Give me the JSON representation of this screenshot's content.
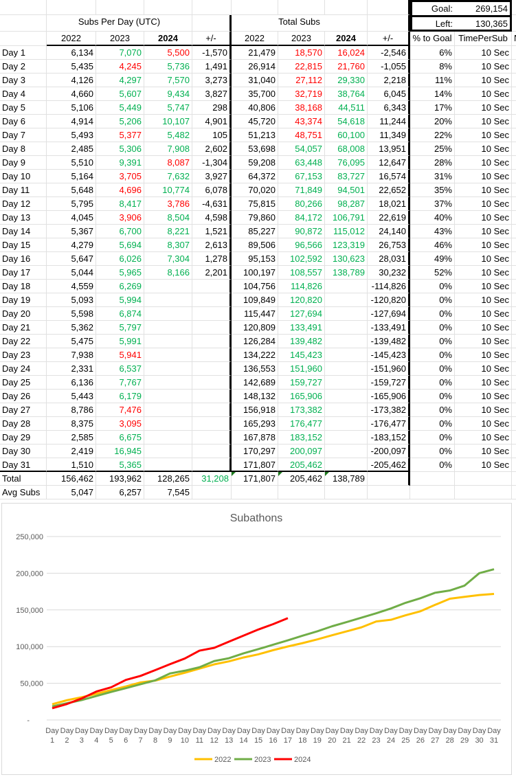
{
  "summary": {
    "goal_label": "Goal:",
    "goal_value": "269,154",
    "left_label": "Left:",
    "left_value": "130,365"
  },
  "headers": {
    "subs_per_day": "Subs Per Day (UTC)",
    "total_subs": "Total Subs",
    "cols": [
      "2022",
      "2023",
      "2024",
      "+/-",
      "2022",
      "2023",
      "2024",
      "+/-",
      "% to Goal",
      "TimePerSub",
      "N"
    ]
  },
  "rows": [
    [
      "Day 1",
      "6,134",
      "7,070",
      "5,500",
      "-1,570",
      "21,479",
      "18,570",
      "16,024",
      "-2,546",
      "6%",
      "10 Sec"
    ],
    [
      "Day 2",
      "5,435",
      "4,245",
      "5,736",
      "1,491",
      "26,914",
      "22,815",
      "21,760",
      "-1,055",
      "8%",
      "10 Sec"
    ],
    [
      "Day 3",
      "4,126",
      "4,297",
      "7,570",
      "3,273",
      "31,040",
      "27,112",
      "29,330",
      "2,218",
      "11%",
      "10 Sec"
    ],
    [
      "Day 4",
      "4,660",
      "5,607",
      "9,434",
      "3,827",
      "35,700",
      "32,719",
      "38,764",
      "6,045",
      "14%",
      "10 Sec"
    ],
    [
      "Day 5",
      "5,106",
      "5,449",
      "5,747",
      "298",
      "40,806",
      "38,168",
      "44,511",
      "6,343",
      "17%",
      "10 Sec"
    ],
    [
      "Day 6",
      "4,914",
      "5,206",
      "10,107",
      "4,901",
      "45,720",
      "43,374",
      "54,618",
      "11,244",
      "20%",
      "10 Sec"
    ],
    [
      "Day 7",
      "5,493",
      "5,377",
      "5,482",
      "105",
      "51,213",
      "48,751",
      "60,100",
      "11,349",
      "22%",
      "10 Sec"
    ],
    [
      "Day 8",
      "2,485",
      "5,306",
      "7,908",
      "2,602",
      "53,698",
      "54,057",
      "68,008",
      "13,951",
      "25%",
      "10 Sec"
    ],
    [
      "Day 9",
      "5,510",
      "9,391",
      "8,087",
      "-1,304",
      "59,208",
      "63,448",
      "76,095",
      "12,647",
      "28%",
      "10 Sec"
    ],
    [
      "Day 10",
      "5,164",
      "3,705",
      "7,632",
      "3,927",
      "64,372",
      "67,153",
      "83,727",
      "16,574",
      "31%",
      "10 Sec"
    ],
    [
      "Day 11",
      "5,648",
      "4,696",
      "10,774",
      "6,078",
      "70,020",
      "71,849",
      "94,501",
      "22,652",
      "35%",
      "10 Sec"
    ],
    [
      "Day 12",
      "5,795",
      "8,417",
      "3,786",
      "-4,631",
      "75,815",
      "80,266",
      "98,287",
      "18,021",
      "37%",
      "10 Sec"
    ],
    [
      "Day 13",
      "4,045",
      "3,906",
      "8,504",
      "4,598",
      "79,860",
      "84,172",
      "106,791",
      "22,619",
      "40%",
      "10 Sec"
    ],
    [
      "Day 14",
      "5,367",
      "6,700",
      "8,221",
      "1,521",
      "85,227",
      "90,872",
      "115,012",
      "24,140",
      "43%",
      "10 Sec"
    ],
    [
      "Day 15",
      "4,279",
      "5,694",
      "8,307",
      "2,613",
      "89,506",
      "96,566",
      "123,319",
      "26,753",
      "46%",
      "10 Sec"
    ],
    [
      "Day 16",
      "5,647",
      "6,026",
      "7,304",
      "1,278",
      "95,153",
      "102,592",
      "130,623",
      "28,031",
      "49%",
      "10 Sec"
    ],
    [
      "Day 17",
      "5,044",
      "5,965",
      "8,166",
      "2,201",
      "100,197",
      "108,557",
      "138,789",
      "30,232",
      "52%",
      "10 Sec"
    ],
    [
      "Day 18",
      "4,559",
      "6,269",
      "",
      "",
      "104,756",
      "114,826",
      "",
      "-114,826",
      "0%",
      "10 Sec"
    ],
    [
      "Day 19",
      "5,093",
      "5,994",
      "",
      "",
      "109,849",
      "120,820",
      "",
      "-120,820",
      "0%",
      "10 Sec"
    ],
    [
      "Day 20",
      "5,598",
      "6,874",
      "",
      "",
      "115,447",
      "127,694",
      "",
      "-127,694",
      "0%",
      "10 Sec"
    ],
    [
      "Day 21",
      "5,362",
      "5,797",
      "",
      "",
      "120,809",
      "133,491",
      "",
      "-133,491",
      "0%",
      "10 Sec"
    ],
    [
      "Day 22",
      "5,475",
      "5,991",
      "",
      "",
      "126,284",
      "139,482",
      "",
      "-139,482",
      "0%",
      "10 Sec"
    ],
    [
      "Day 23",
      "7,938",
      "5,941",
      "",
      "",
      "134,222",
      "145,423",
      "",
      "-145,423",
      "0%",
      "10 Sec"
    ],
    [
      "Day 24",
      "2,331",
      "6,537",
      "",
      "",
      "136,553",
      "151,960",
      "",
      "-151,960",
      "0%",
      "10 Sec"
    ],
    [
      "Day 25",
      "6,136",
      "7,767",
      "",
      "",
      "142,689",
      "159,727",
      "",
      "-159,727",
      "0%",
      "10 Sec"
    ],
    [
      "Day 26",
      "5,443",
      "6,179",
      "",
      "",
      "148,132",
      "165,906",
      "",
      "-165,906",
      "0%",
      "10 Sec"
    ],
    [
      "Day 27",
      "8,786",
      "7,476",
      "",
      "",
      "156,918",
      "173,382",
      "",
      "-173,382",
      "0%",
      "10 Sec"
    ],
    [
      "Day 28",
      "8,375",
      "3,095",
      "",
      "",
      "165,293",
      "176,477",
      "",
      "-176,477",
      "0%",
      "10 Sec"
    ],
    [
      "Day 29",
      "2,585",
      "6,675",
      "",
      "",
      "167,878",
      "183,152",
      "",
      "-183,152",
      "0%",
      "10 Sec"
    ],
    [
      "Day 30",
      "2,419",
      "16,945",
      "",
      "",
      "170,297",
      "200,097",
      "",
      "-200,097",
      "0%",
      "10 Sec"
    ],
    [
      "Day 31",
      "1,510",
      "5,365",
      "",
      "",
      "171,807",
      "205,462",
      "",
      "-205,462",
      "0%",
      "10 Sec"
    ]
  ],
  "total_row": [
    "Total",
    "156,462",
    "193,962",
    "128,265",
    "31,208",
    "171,807",
    "205,462",
    "138,789"
  ],
  "avg_row": [
    "Avg Subs",
    "5,047",
    "6,257",
    "7,545"
  ],
  "colors": {
    "up": "#00B050",
    "down": "#FF0000",
    "s2022": "#FFC000",
    "s2023": "#70AD47",
    "s2024": "#FF0000"
  },
  "chart_data": {
    "type": "line",
    "title": "Subathons",
    "categories": [
      "Day 1",
      "Day 2",
      "Day 3",
      "Day 4",
      "Day 5",
      "Day 6",
      "Day 7",
      "Day 8",
      "Day 9",
      "Day 10",
      "Day 11",
      "Day 12",
      "Day 13",
      "Day 14",
      "Day 15",
      "Day 16",
      "Day 17",
      "Day 18",
      "Day 19",
      "Day 20",
      "Day 21",
      "Day 22",
      "Day 23",
      "Day 24",
      "Day 25",
      "Day 26",
      "Day 27",
      "Day 28",
      "Day 29",
      "Day 30",
      "Day 31"
    ],
    "yticks": [
      "-",
      "50,000",
      "100,000",
      "150,000",
      "200,000",
      "250,000"
    ],
    "ylim": [
      0,
      250000
    ],
    "legend": "bottom",
    "series": [
      {
        "name": "2022",
        "values": [
          21479,
          26914,
          31040,
          35700,
          40806,
          45720,
          51213,
          53698,
          59208,
          64372,
          70020,
          75815,
          79860,
          85227,
          89506,
          95153,
          100197,
          104756,
          109849,
          115447,
          120809,
          126284,
          134222,
          136553,
          142689,
          148132,
          156918,
          165293,
          167878,
          170297,
          171807
        ]
      },
      {
        "name": "2023",
        "values": [
          18570,
          22815,
          27112,
          32719,
          38168,
          43374,
          48751,
          54057,
          63448,
          67153,
          71849,
          80266,
          84172,
          90872,
          96566,
          102592,
          108557,
          114826,
          120820,
          127694,
          133491,
          139482,
          145423,
          151960,
          159727,
          165906,
          173382,
          176477,
          183152,
          200097,
          205462
        ]
      },
      {
        "name": "2024",
        "values": [
          16024,
          21760,
          29330,
          38764,
          44511,
          54618,
          60100,
          68008,
          76095,
          83727,
          94501,
          98287,
          106791,
          115012,
          123319,
          130623,
          138789
        ]
      }
    ]
  }
}
